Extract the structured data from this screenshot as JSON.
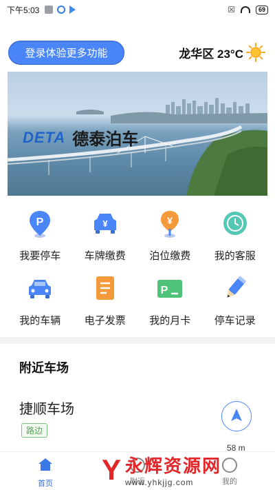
{
  "status_bar": {
    "time": "下午5:03",
    "battery": "69",
    "icons": [
      "notification-icon",
      "browser-icon",
      "play-icon",
      "close-box-icon",
      "wifi-icon",
      "battery-icon"
    ]
  },
  "header": {
    "login_label": "登录体验更多功能",
    "weather_text": "龙华区 23°C",
    "weather_icon": "sun-icon"
  },
  "banner": {
    "logo_mark": "DETA",
    "logo_text": "德泰泊车"
  },
  "grid": [
    {
      "label": "我要停车",
      "icon": "parking-pin-icon"
    },
    {
      "label": "车牌缴费",
      "icon": "car-yen-icon"
    },
    {
      "label": "泊位缴费",
      "icon": "yen-pin-icon"
    },
    {
      "label": "我的客服",
      "icon": "clock-icon"
    },
    {
      "label": "我的车辆",
      "icon": "car-icon"
    },
    {
      "label": "电子发票",
      "icon": "invoice-icon"
    },
    {
      "label": "我的月卡",
      "icon": "parking-card-icon"
    },
    {
      "label": "停车记录",
      "icon": "pencil-icon"
    }
  ],
  "nearby": {
    "title": "附近车场",
    "lot_name": "捷顺车场",
    "lot_tag": "路边",
    "distance": "58 m"
  },
  "bottom_nav": {
    "home": "首页",
    "near": "附近",
    "mine": "我的"
  },
  "watermark": {
    "title": "永辉资源网",
    "url": "www.yhkjjg.com"
  },
  "colors": {
    "accent": "#4a86f7",
    "tag_green": "#5aa35a",
    "watermark_red": "#e2262a"
  }
}
